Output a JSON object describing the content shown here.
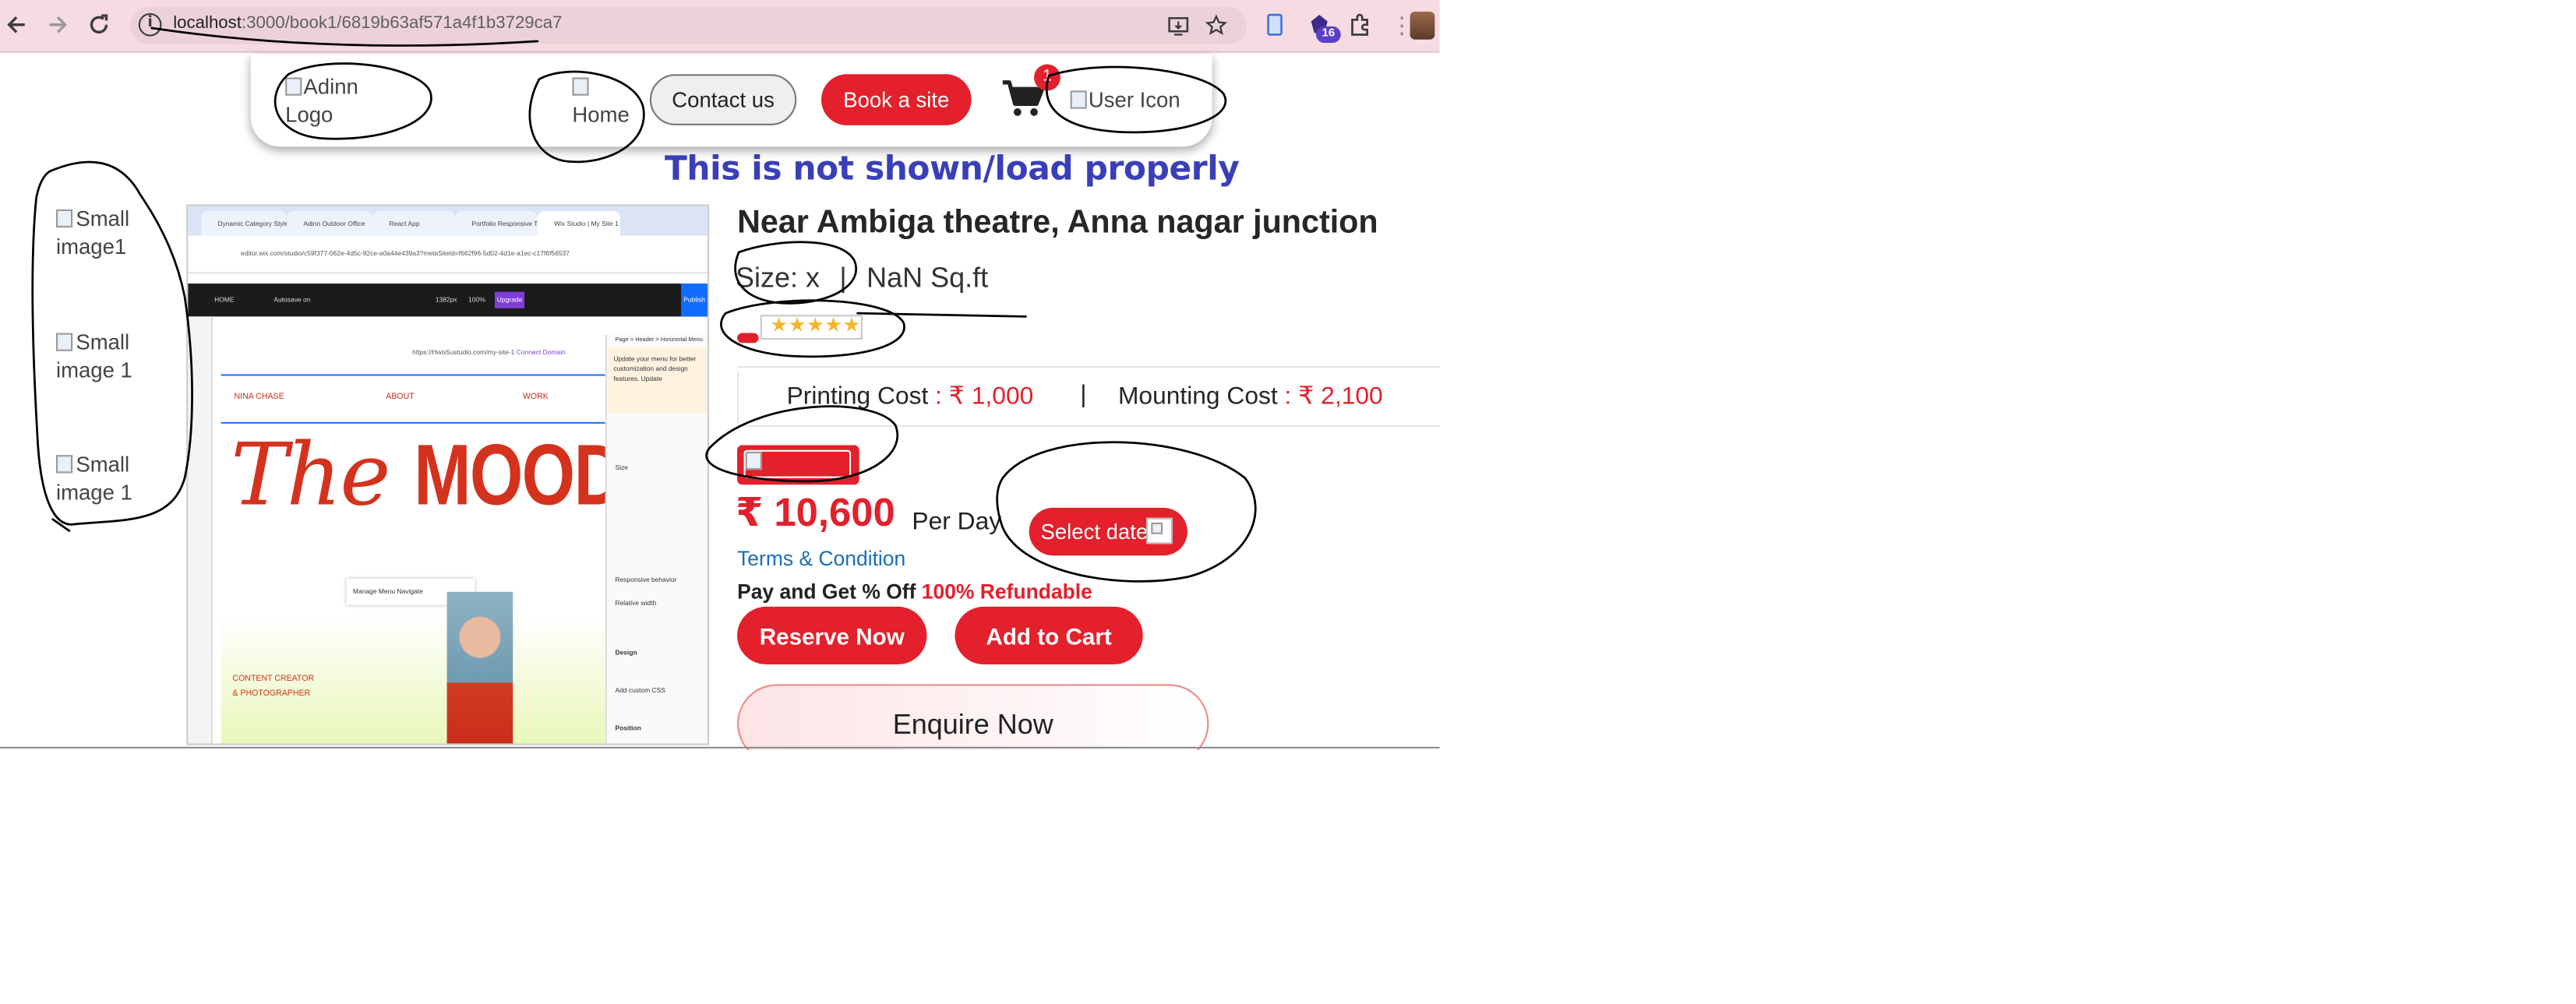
{
  "browser": {
    "url_host": "localhost",
    "url_path": ":3000/book1/6819b63af571a4f1b3729ca7",
    "extension_badge": "16",
    "icons": [
      "back-icon",
      "forward-icon",
      "reload-icon",
      "info-icon",
      "install-app-icon",
      "bookmark-star-icon",
      "extension-icon",
      "puzzle-icon",
      "profile-avatar"
    ]
  },
  "header": {
    "logo_alt": "Adinn Logo",
    "home_alt": "Home",
    "contact_label": "Contact us",
    "book_label": "Book a site",
    "cart_count": "1",
    "user_alt": "User Icon"
  },
  "annotation": {
    "text": "This is not shown/load properly",
    "color": "#3a3fb8",
    "scribble_color": "#000000"
  },
  "thumbnails": [
    {
      "alt": "Small image1"
    },
    {
      "alt": "Small image 1"
    },
    {
      "alt": "Small image 1"
    }
  ],
  "main_image": {
    "tabs": [
      "Dynamic Category Style",
      "Adinn Outdoor Office",
      "React App",
      "Portfolio Responsive Tm",
      "Wix Studio | My Site 1"
    ],
    "address": "editor.wix.com/studio/c59f377-062e-4d5c-92ce-a0a44e439a3?metaSiteId=f662f96-5d02-4d1e-a1ec-c17f6f56537",
    "toolbar": [
      "HOME",
      "Autosave on",
      "1382px",
      "100%",
      "Upgrade",
      "Publish"
    ],
    "domain_prefix": "https://Hwix5ustudio.com/my-site-1",
    "domain_link": "Connect Domain",
    "nav": [
      "NINA CHASE",
      "ABOUT",
      "WORK"
    ],
    "headline_italic": "The",
    "headline_bold": "MOOD SWIN",
    "menu_text": "Manage Menu   Navigate",
    "creator": [
      "CONTENT CREATOR",
      "& PHOTOGRAPHER"
    ],
    "panel_tip": "Update your menu for better customization and design features. Update",
    "panel_rows": [
      "Size",
      "Responsive behavior",
      "Relative width",
      "Design",
      "Add custom CSS",
      "Position"
    ],
    "breadcrumb": "Page > Header > Horizontal Menu"
  },
  "product": {
    "title": "Near Ambiga theatre, Anna nagar junction",
    "size_label": "Size: x",
    "size_sep": "|",
    "size_value": "NaN Sq.ft",
    "rating_stars": 5,
    "printing_label": "Printing Cost",
    "printing_value": ": ₹ 1,000",
    "cost_sep": "|",
    "mounting_label": "Mounting Cost",
    "mounting_value": ": ₹ 2,100",
    "price": "₹ 10,600",
    "per_day": "Per Day",
    "select_date": "Select date",
    "terms": "Terms & Condition",
    "pay_text": "Pay and Get % Off",
    "refund_text": "100% Refundable",
    "reserve_label": "Reserve Now",
    "add_cart_label": "Add to Cart",
    "enquire_label": "Enquire Now"
  },
  "colors": {
    "brand_red": "#e3202b",
    "toolbar_bg": "#f7dbe2",
    "link_blue": "#1a6fb5"
  }
}
